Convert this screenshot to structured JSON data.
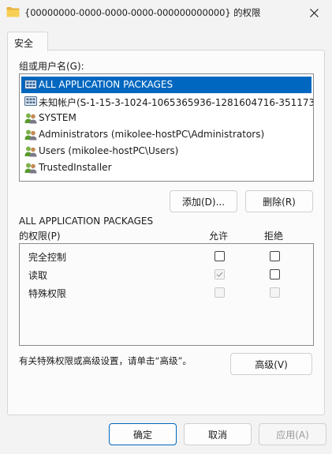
{
  "window": {
    "title": "{00000000-0000-0000-0000-000000000000} 的权限",
    "icon": "folder-icon",
    "close_icon": "close-icon"
  },
  "tabs": [
    {
      "label": "安全",
      "selected": true
    }
  ],
  "groups": {
    "label": "组或用户名(G):",
    "items": [
      {
        "label": "ALL APPLICATION PACKAGES",
        "icon": "app-packages-icon",
        "selected": true
      },
      {
        "label": "未知帐户(S-1-15-3-1024-1065365936-1281604716-351173…",
        "icon": "unknown-account-icon",
        "selected": false
      },
      {
        "label": "SYSTEM",
        "icon": "users-icon",
        "selected": false
      },
      {
        "label": "Administrators (mikolee-hostPC\\Administrators)",
        "icon": "users-icon",
        "selected": false
      },
      {
        "label": "Users (mikolee-hostPC\\Users)",
        "icon": "users-icon",
        "selected": false
      },
      {
        "label": "TrustedInstaller",
        "icon": "users-icon",
        "selected": false
      }
    ],
    "add_button": "添加(D)...",
    "remove_button": "删除(R)"
  },
  "permissions": {
    "heading_line1": "ALL APPLICATION PACKAGES",
    "heading_line2": "的权限(P)",
    "allow_header": "允许",
    "deny_header": "拒绝",
    "rows": [
      {
        "name": "完全控制",
        "allow": false,
        "allow_disabled": false,
        "deny": false,
        "deny_disabled": false
      },
      {
        "name": "读取",
        "allow": true,
        "allow_disabled": true,
        "deny": false,
        "deny_disabled": false
      },
      {
        "name": "特殊权限",
        "allow": false,
        "allow_disabled": true,
        "deny": false,
        "deny_disabled": true
      }
    ]
  },
  "advanced": {
    "hint": "有关特殊权限或高级设置，请单击“高级”。",
    "button": "高级(V)"
  },
  "footer": {
    "ok": "确定",
    "cancel": "取消",
    "apply": "应用(A)"
  },
  "colors": {
    "accent": "#0067c0",
    "window_bg": "#f3f3f3",
    "panel_bg": "#fbfbfb"
  }
}
